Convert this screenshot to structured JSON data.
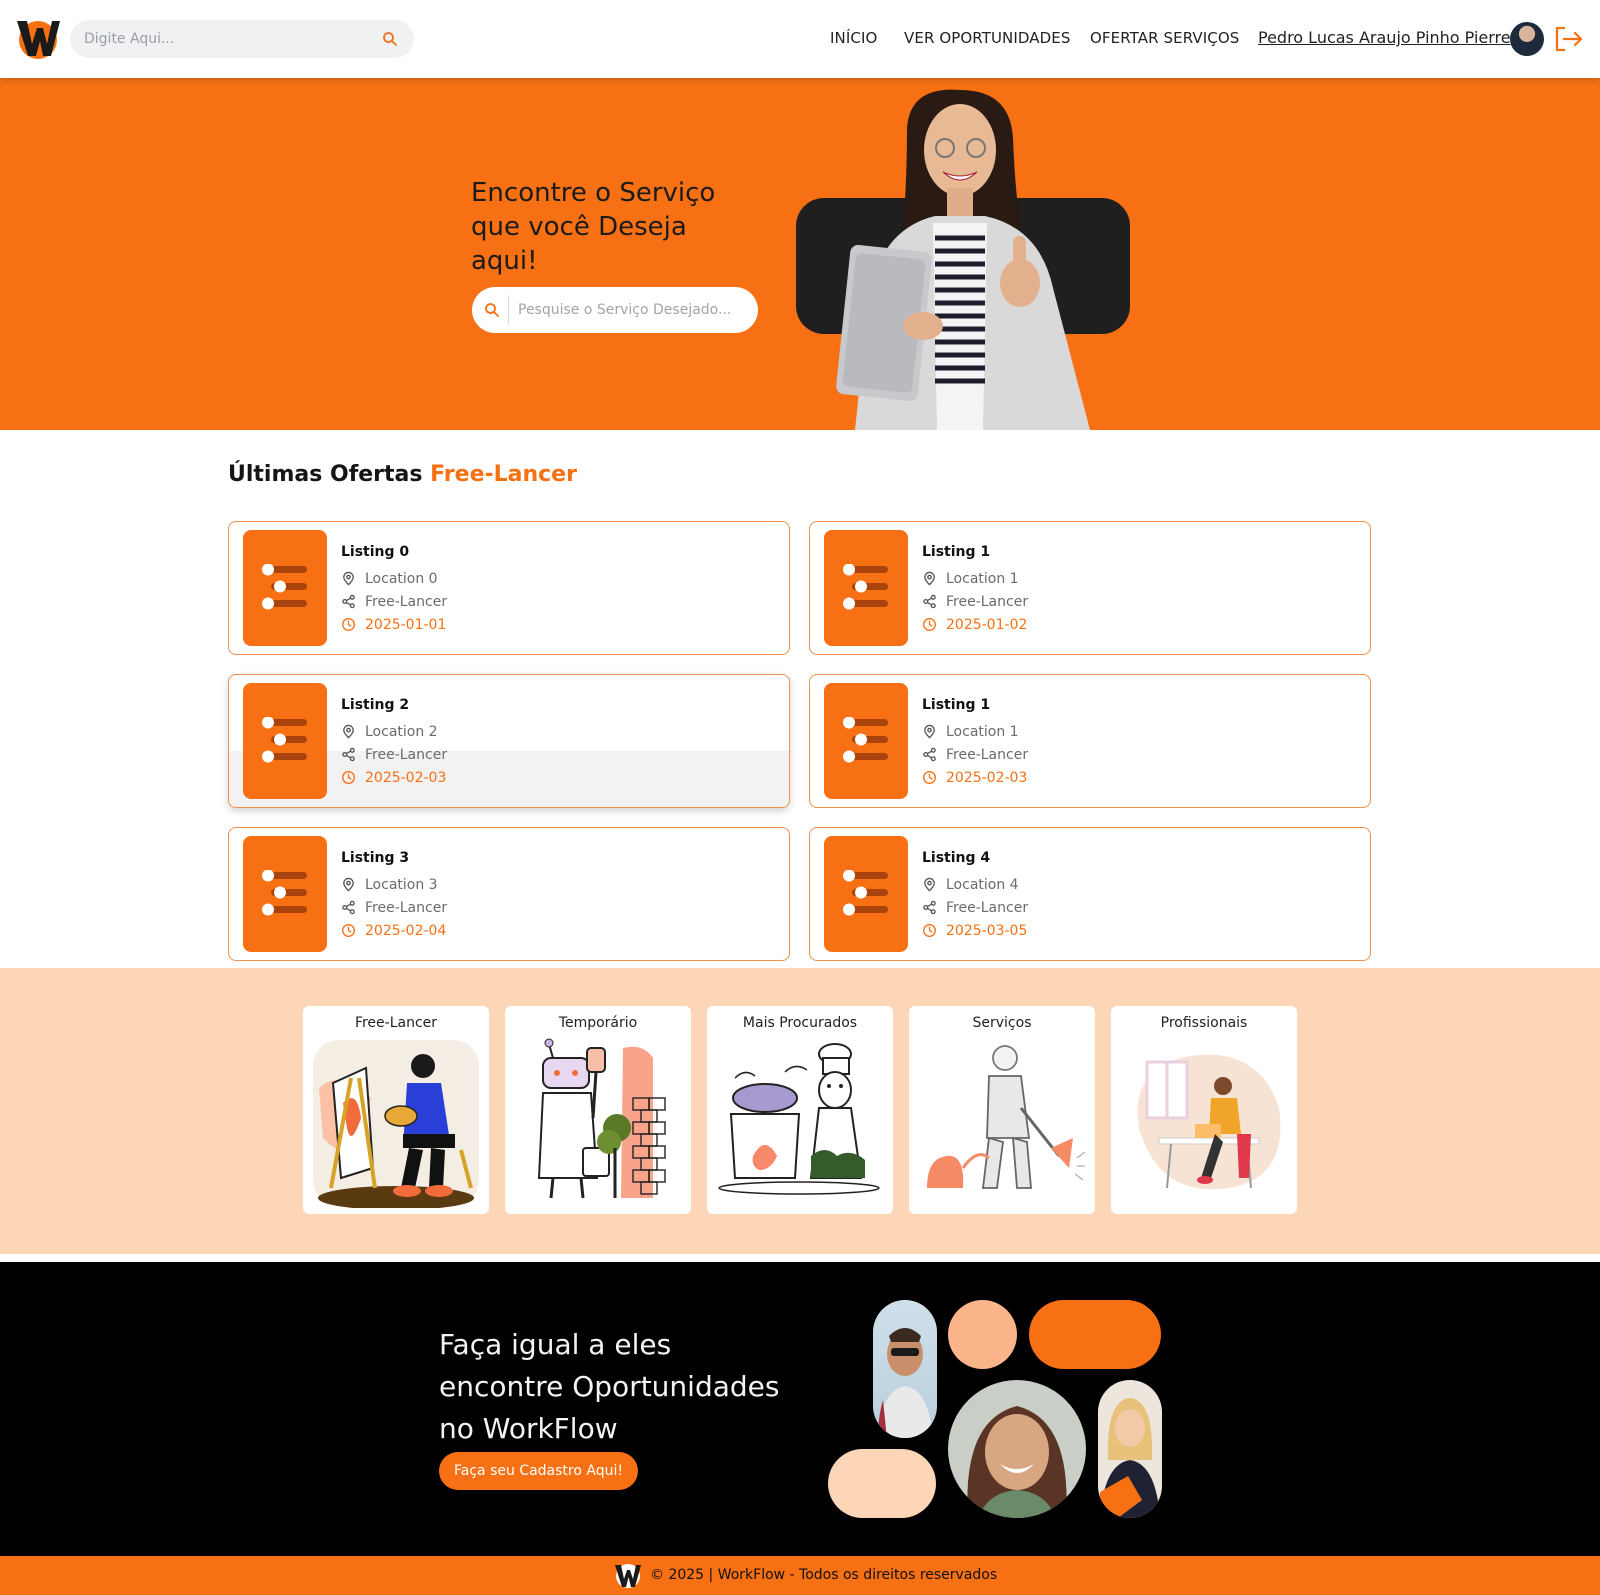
{
  "header": {
    "search_placeholder": "Digite Aqui...",
    "nav": [
      "INÍCIO",
      "VER OPORTUNIDADES",
      "OFERTAR SERVIÇOS"
    ],
    "user_name": "Pedro Lucas Araujo Pinho Pierre"
  },
  "hero": {
    "title": "Encontre o Serviço que você Deseja aqui!",
    "search_placeholder": "Pesquise o Serviço Desejado..."
  },
  "offers": {
    "title": "Últimas Ofertas",
    "title_accent": "Free-Lancer",
    "items": [
      {
        "title": "Listing 0",
        "location": "Location 0",
        "type": "Free-Lancer",
        "date": "2025-01-01"
      },
      {
        "title": "Listing 1",
        "location": "Location 1",
        "type": "Free-Lancer",
        "date": "2025-01-02"
      },
      {
        "title": "Listing 2",
        "location": "Location 2",
        "type": "Free-Lancer",
        "date": "2025-02-03"
      },
      {
        "title": "Listing 1",
        "location": "Location 1",
        "type": "Free-Lancer",
        "date": "2025-02-03"
      },
      {
        "title": "Listing 3",
        "location": "Location 3",
        "type": "Free-Lancer",
        "date": "2025-02-04"
      },
      {
        "title": "Listing 4",
        "location": "Location 4",
        "type": "Free-Lancer",
        "date": "2025-03-05"
      }
    ]
  },
  "categories": [
    "Free-Lancer",
    "Temporário",
    "Mais Procurados",
    "Serviços",
    "Profissionais"
  ],
  "cta": {
    "text": "Faça igual a eles encontre Oportunidades no WorkFlow",
    "button": "Faça seu Cadastro Aqui!"
  },
  "footer": {
    "text": "© 2025 | WorkFlow - Todos os direitos reservados"
  },
  "colors": {
    "accent": "#f77014",
    "peach": "#fdd6b8",
    "dark": "#000000"
  }
}
